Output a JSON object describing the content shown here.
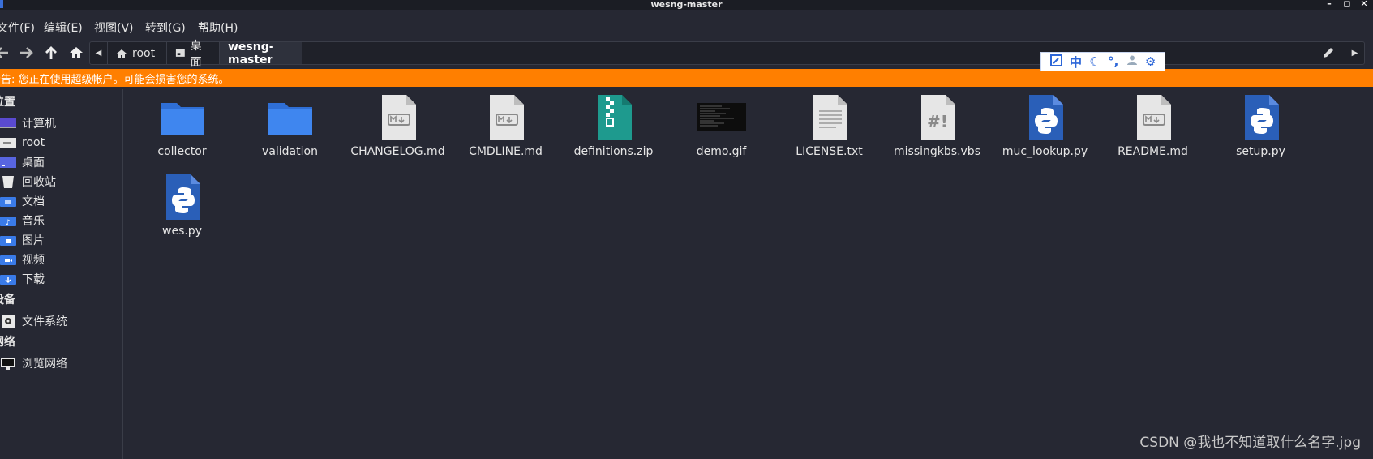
{
  "window": {
    "title": "wesng-master",
    "buttons": [
      "–",
      "◻",
      "✕"
    ]
  },
  "menu": [
    "文件(F)",
    "编辑(E)",
    "视图(V)",
    "转到(G)",
    "帮助(H)"
  ],
  "pathbar": {
    "segments": [
      "root",
      "桌面",
      "wesng-master"
    ]
  },
  "ime": {
    "lang": "中"
  },
  "warning": "警告: 您正在使用超级帐户。可能会损害您的系统。",
  "sidebar": {
    "places_title": "位置",
    "places": [
      "计算机",
      "root",
      "桌面",
      "回收站",
      "文档",
      "音乐",
      "图片",
      "视频",
      "下载"
    ],
    "devices_title": "设备",
    "devices": [
      "文件系统"
    ],
    "network_title": "网络",
    "network": [
      "浏览网络"
    ]
  },
  "files": [
    {
      "name": "collector",
      "type": "folder"
    },
    {
      "name": "validation",
      "type": "folder"
    },
    {
      "name": "CHANGELOG.md",
      "type": "markdown"
    },
    {
      "name": "CMDLINE.md",
      "type": "markdown"
    },
    {
      "name": "definitions.zip",
      "type": "zip"
    },
    {
      "name": "demo.gif",
      "type": "image"
    },
    {
      "name": "LICENSE.txt",
      "type": "text"
    },
    {
      "name": "missingkbs.vbs",
      "type": "script"
    },
    {
      "name": "muc_lookup.py",
      "type": "python"
    },
    {
      "name": "README.md",
      "type": "markdown"
    },
    {
      "name": "setup.py",
      "type": "python"
    },
    {
      "name": "wes.py",
      "type": "python"
    }
  ],
  "watermark": "CSDN @我也不知道取什么名字.jpg",
  "colors": {
    "accent_warning": "#ff7f00",
    "folder": "#3a7be8",
    "python": "#2a5fb8",
    "zip": "#1e9a8e"
  }
}
